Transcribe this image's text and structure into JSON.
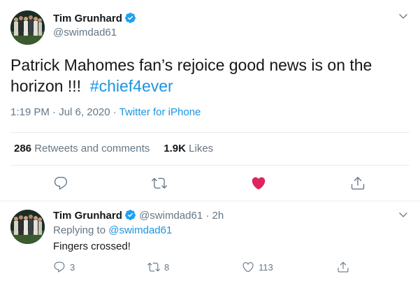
{
  "main_tweet": {
    "display_name": "Tim Grunhard",
    "handle": "@swimdad61",
    "text": "Patrick Mahomes fan’s rejoice good news is on the horizon !!!",
    "hashtag": "#chief4ever",
    "time": "1:19 PM",
    "date": "Jul 6, 2020",
    "source": "Twitter for iPhone",
    "retweets_count": "286",
    "retweets_label": "Retweets and comments",
    "likes_count": "1.9K",
    "likes_label": "Likes",
    "liked_color": "#e0245e"
  },
  "reply": {
    "display_name": "Tim Grunhard",
    "handle": "@swimdad61",
    "age": "2h",
    "replying_to_label": "Replying to",
    "replying_to_handle": "@swimdad61",
    "text": "Fingers crossed!",
    "reply_count": "3",
    "retweet_count": "8",
    "like_count": "113"
  },
  "colors": {
    "link": "#1b95e0",
    "secondary_text": "#657786",
    "primary_text": "#14171a",
    "divider": "#e6ecf0"
  }
}
